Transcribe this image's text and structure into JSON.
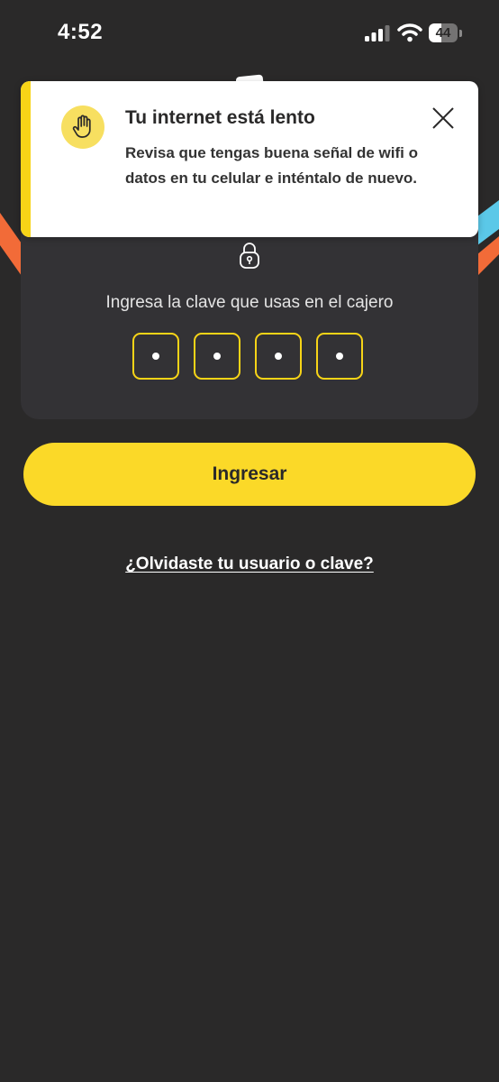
{
  "status_bar": {
    "time": "4:52",
    "signal_icon": "cellular-signal-icon",
    "wifi_icon": "wifi-icon",
    "battery_icon": "battery-icon",
    "battery_level": "44",
    "battery_fraction": 0.44
  },
  "toast": {
    "icon": "raised-hand-icon",
    "title": "Tu internet está lento",
    "message": "Revisa que tengas buena señal de wifi o datos en tu celular e inténtalo de nuevo.",
    "close_icon": "close-icon",
    "accent_color": "#f7d417"
  },
  "login": {
    "lock_icon": "lock-icon",
    "pin_label": "Ingresa la clave que usas en el cajero",
    "pin_digits_entered": 4,
    "pin_box_color": "#f7d417"
  },
  "actions": {
    "submit_label": "Ingresar",
    "submit_color": "#fbd928",
    "forgot_label": "¿Olvidaste tu usuario o clave?"
  },
  "colors": {
    "background": "#2a2929",
    "card": "#333235",
    "ribbon_orange": "#f26b38",
    "ribbon_blue": "#5bc8e8"
  }
}
